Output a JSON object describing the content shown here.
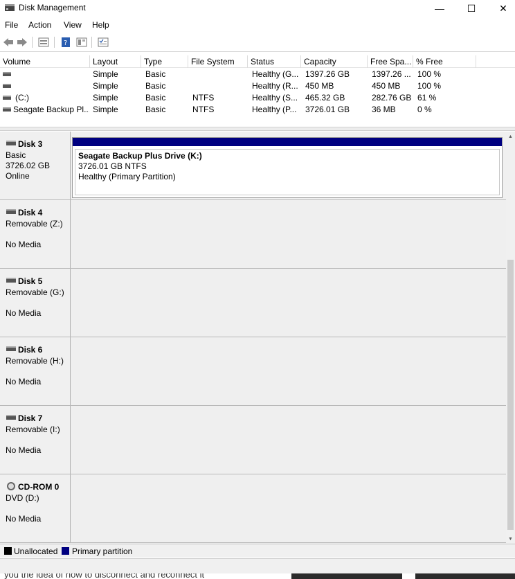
{
  "window": {
    "title": "Disk Management",
    "minimize": "—",
    "maximize": "☐",
    "close": "✕"
  },
  "menu": [
    "File",
    "Action",
    "View",
    "Help"
  ],
  "toolbar": [
    "back-arrow-icon",
    "forward-arrow-icon",
    "disk-list-icon",
    "help-icon",
    "properties-icon",
    "checklist-icon"
  ],
  "volume_table": {
    "columns": [
      "Volume",
      "Layout",
      "Type",
      "File System",
      "Status",
      "Capacity",
      "Free Spa...",
      "% Free"
    ],
    "rows": [
      [
        "",
        "Simple",
        "Basic",
        "",
        "Healthy (G...",
        "1397.26 GB",
        "1397.26 ...",
        "100 %"
      ],
      [
        "",
        "Simple",
        "Basic",
        "",
        "Healthy (R...",
        "450 MB",
        "450 MB",
        "100 %"
      ],
      [
        "(C:)",
        "Simple",
        "Basic",
        "NTFS",
        "Healthy (S...",
        "465.32 GB",
        "282.76 GB",
        "61 %"
      ],
      [
        "Seagate Backup Pl...",
        "Simple",
        "Basic",
        "NTFS",
        "Healthy (P...",
        "3726.01 GB",
        "36 MB",
        "0 %"
      ]
    ]
  },
  "disks": [
    {
      "name": "Disk 3",
      "line1": "Basic",
      "line2": "3726.02 GB",
      "line3": "Online",
      "icon": "hard-disk-icon",
      "partition": {
        "title": "Seagate Backup Plus Drive  (K:)",
        "size": "3726.01 GB NTFS",
        "status": "Healthy (Primary Partition)"
      }
    },
    {
      "name": "Disk 4",
      "line1": "Removable (Z:)",
      "line2": "",
      "line3": "No Media",
      "icon": "removable-disk-icon"
    },
    {
      "name": "Disk 5",
      "line1": "Removable (G:)",
      "line2": "",
      "line3": "No Media",
      "icon": "removable-disk-icon"
    },
    {
      "name": "Disk 6",
      "line1": "Removable (H:)",
      "line2": "",
      "line3": "No Media",
      "icon": "removable-disk-icon"
    },
    {
      "name": "Disk 7",
      "line1": "Removable (I:)",
      "line2": "",
      "line3": "No Media",
      "icon": "removable-disk-icon"
    },
    {
      "name": "CD-ROM 0",
      "line1": "DVD (D:)",
      "line2": "",
      "line3": "No Media",
      "icon": "cd-rom-icon"
    }
  ],
  "legend": [
    {
      "label": "Unallocated",
      "color": "#000000"
    },
    {
      "label": "Primary partition",
      "color": "#000080"
    }
  ],
  "background_text": "you the idea of how to disconnect and reconnect it"
}
